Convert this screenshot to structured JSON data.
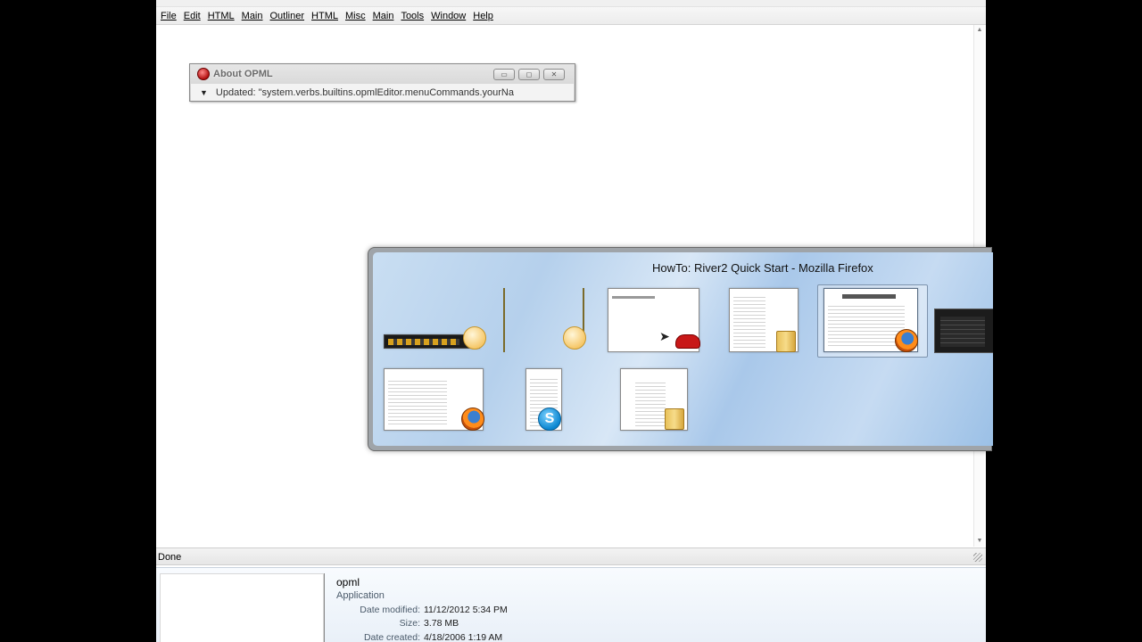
{
  "menu": [
    "File",
    "Edit",
    "HTML",
    "Main",
    "Outliner",
    "HTML",
    "Misc",
    "Main",
    "Tools",
    "Window",
    "Help"
  ],
  "about_window": {
    "title": "About OPML",
    "message": "Updated: \"system.verbs.builtins.opmlEditor.menuCommands.yourNa"
  },
  "status": {
    "text": "Done"
  },
  "switcher": {
    "title": "HowTo: River2 Quick Start - Mozilla Firefox",
    "windows": [
      {
        "name": "media-player-window",
        "icon": "user-icon"
      },
      {
        "name": "blank-window",
        "icon": "user-icon"
      },
      {
        "name": "opml-editor-window",
        "icon": "car-icon"
      },
      {
        "name": "explorer-window-1",
        "icon": "folder-icon"
      },
      {
        "name": "firefox-river2-window",
        "icon": "firefox-icon",
        "selected": true
      },
      {
        "name": "firefox-window-2",
        "icon": "firefox-icon"
      },
      {
        "name": "skype-window",
        "icon": "skype-icon"
      },
      {
        "name": "explorer-window-2",
        "icon": "folder-icon"
      }
    ]
  },
  "details": {
    "name": "opml",
    "type": "Application",
    "date_modified_label": "Date modified:",
    "date_modified": "11/12/2012 5:34 PM",
    "size_label": "Size:",
    "size": "3.78 MB",
    "date_created_label": "Date created:",
    "date_created": "4/18/2006 1:19 AM"
  }
}
